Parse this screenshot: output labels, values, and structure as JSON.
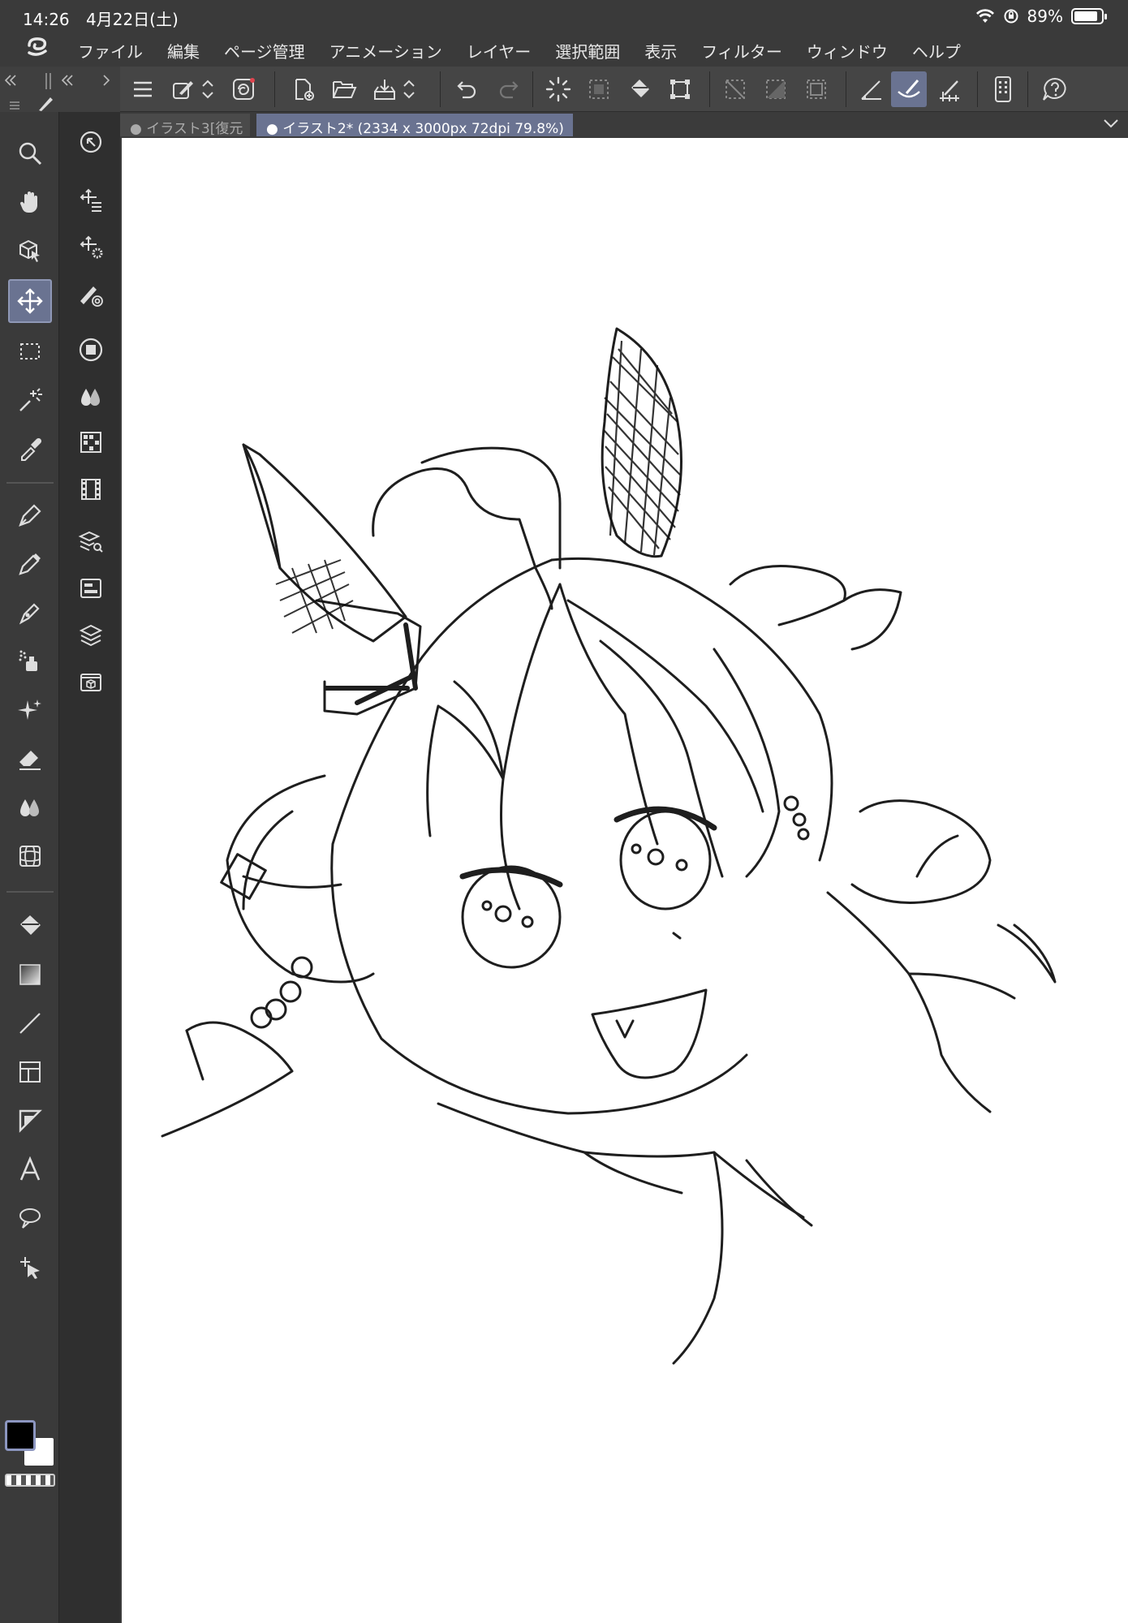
{
  "status": {
    "time": "14:26",
    "date": "4月22日(土)",
    "battery": "89%"
  },
  "menu": [
    "ファイル",
    "編集",
    "ページ管理",
    "アニメーション",
    "レイヤー",
    "選択範囲",
    "表示",
    "フィルター",
    "ウィンドウ",
    "ヘルプ"
  ],
  "tabs": [
    {
      "label": "● イラスト3[復元"
    },
    {
      "label": "● イラスト2* (2334 x 3000px 72dpi 79.8%)"
    }
  ],
  "colors": {
    "accent": "#6a7391",
    "panel": "#3a3a3a",
    "canvas": "#ffffff",
    "foreground": "#000000",
    "background": "#ffffff"
  }
}
